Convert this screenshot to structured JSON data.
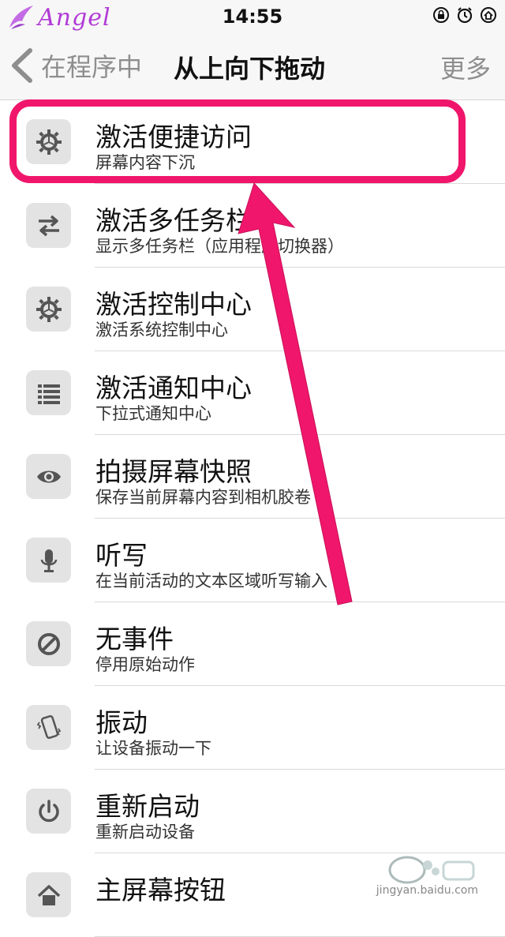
{
  "status": {
    "carrier": "Angel",
    "time": "14:55"
  },
  "nav": {
    "back_label": "在程序中",
    "title": "从上向下拖动",
    "more_label": "更多"
  },
  "items": [
    {
      "title": "激活便捷访问",
      "subtitle": "屏幕内容下沉",
      "icon": "gear-icon"
    },
    {
      "title": "激活多任务栏",
      "subtitle": "显示多任务栏（应用程序切换器）",
      "icon": "swap-arrows-icon"
    },
    {
      "title": "激活控制中心",
      "subtitle": "激活系统控制中心",
      "icon": "gear-icon"
    },
    {
      "title": "激活通知中心",
      "subtitle": "下拉式通知中心",
      "icon": "list-icon"
    },
    {
      "title": "拍摄屏幕快照",
      "subtitle": "保存当前屏幕内容到相机胶卷",
      "icon": "eye-icon"
    },
    {
      "title": "听写",
      "subtitle": "在当前活动的文本区域听写输入",
      "icon": "microphone-icon"
    },
    {
      "title": "无事件",
      "subtitle": "停用原始动作",
      "icon": "no-entry-icon"
    },
    {
      "title": "振动",
      "subtitle": "让设备振动一下",
      "icon": "vibrate-phone-icon"
    },
    {
      "title": "重新启动",
      "subtitle": "重新启动设备",
      "icon": "power-icon"
    },
    {
      "title": "主屏幕按钮",
      "subtitle": "",
      "icon": "home-icon"
    }
  ],
  "colors": {
    "highlight": "#f0166b",
    "icon_bg": "#e3e3e3",
    "icon_fg": "#555555"
  },
  "watermark": {
    "text": "jingyan.baidu.com"
  }
}
